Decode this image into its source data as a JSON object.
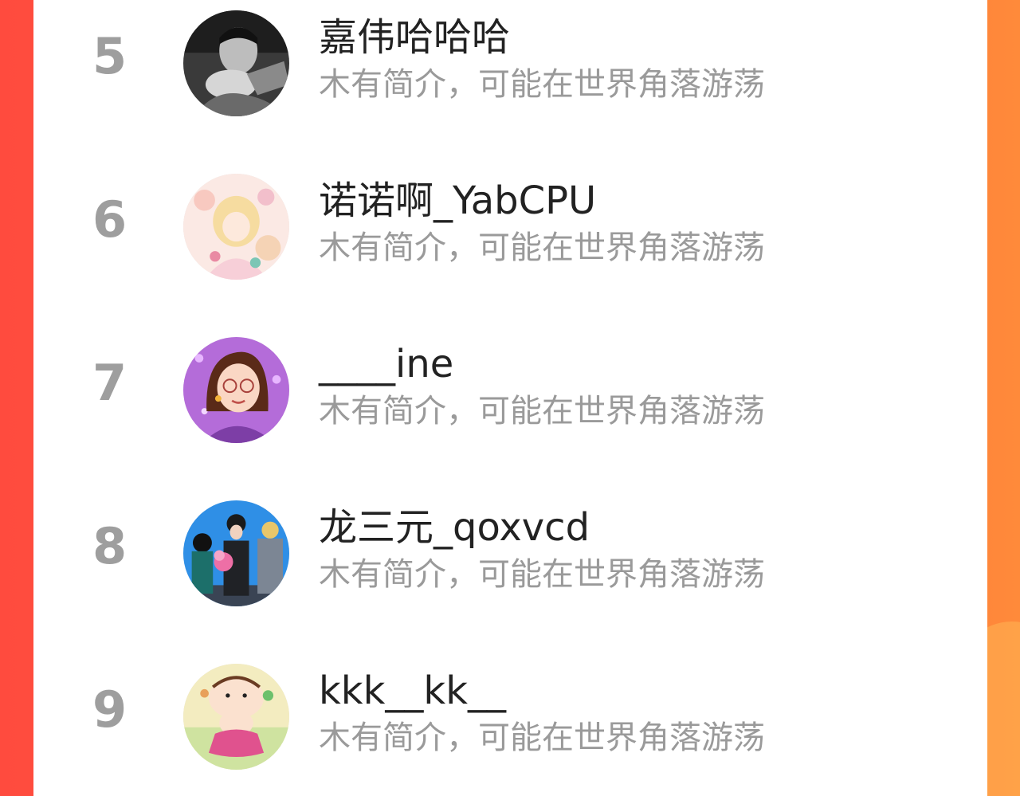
{
  "colors": {
    "frame_left": "#ff4b3e",
    "frame_right": "#ff8a3a",
    "rank": "#9e9e9e",
    "name": "#222222",
    "bio": "#9a9a9a"
  },
  "users": [
    {
      "rank": "5",
      "name": "嘉伟哈哈哈",
      "bio": "木有简介，可能在世界角落游荡",
      "avatar": "photo-avatar-man"
    },
    {
      "rank": "6",
      "name": "诺诺啊_YabCPU",
      "bio": "木有简介，可能在世界角落游荡",
      "avatar": "anime-girl-avatar"
    },
    {
      "rank": "7",
      "name": "____ine",
      "bio": "木有简介，可能在世界角落游荡",
      "avatar": "cartoon-woman-avatar"
    },
    {
      "rank": "8",
      "name": "龙三元_qoxvcd",
      "bio": "木有简介，可能在世界角落游荡",
      "avatar": "group-photo-avatar"
    },
    {
      "rank": "9",
      "name": "kkk__kk__",
      "bio": "木有简介，可能在世界角落游荡",
      "avatar": "cartoon-kid-avatar"
    }
  ]
}
